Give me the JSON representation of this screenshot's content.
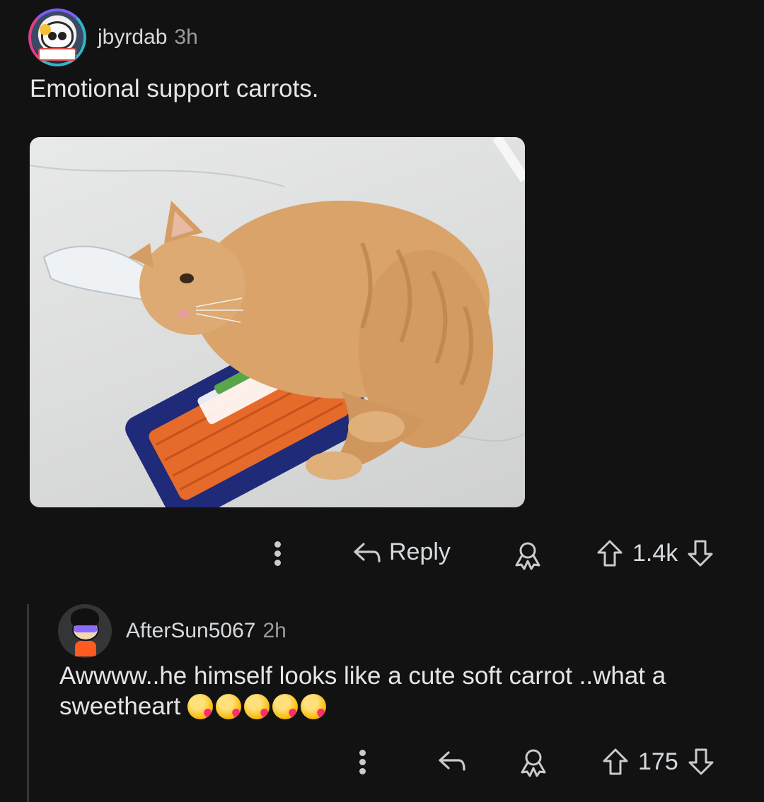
{
  "post_comment": {
    "username": "jbyrdab",
    "timestamp": "3h",
    "text": "Emotional support carrots.",
    "actions": {
      "reply_label": "Reply",
      "vote_count": "1.4k"
    }
  },
  "reply_comment": {
    "username": "AfterSun5067",
    "timestamp": "2h",
    "text": "Awwww..he himself looks like a cute soft carrot ..what a sweetheart",
    "emoji_count": 5,
    "actions": {
      "vote_count": "175"
    }
  },
  "icons": {
    "more": "more-dots-icon",
    "reply": "reply-arrow-icon",
    "award": "award-icon",
    "upvote": "upvote-arrow-icon",
    "downvote": "downvote-arrow-icon"
  },
  "colors": {
    "background": "#121213",
    "text": "#d7dadc",
    "muted": "#9a9d9f",
    "thread_line": "#343536"
  }
}
